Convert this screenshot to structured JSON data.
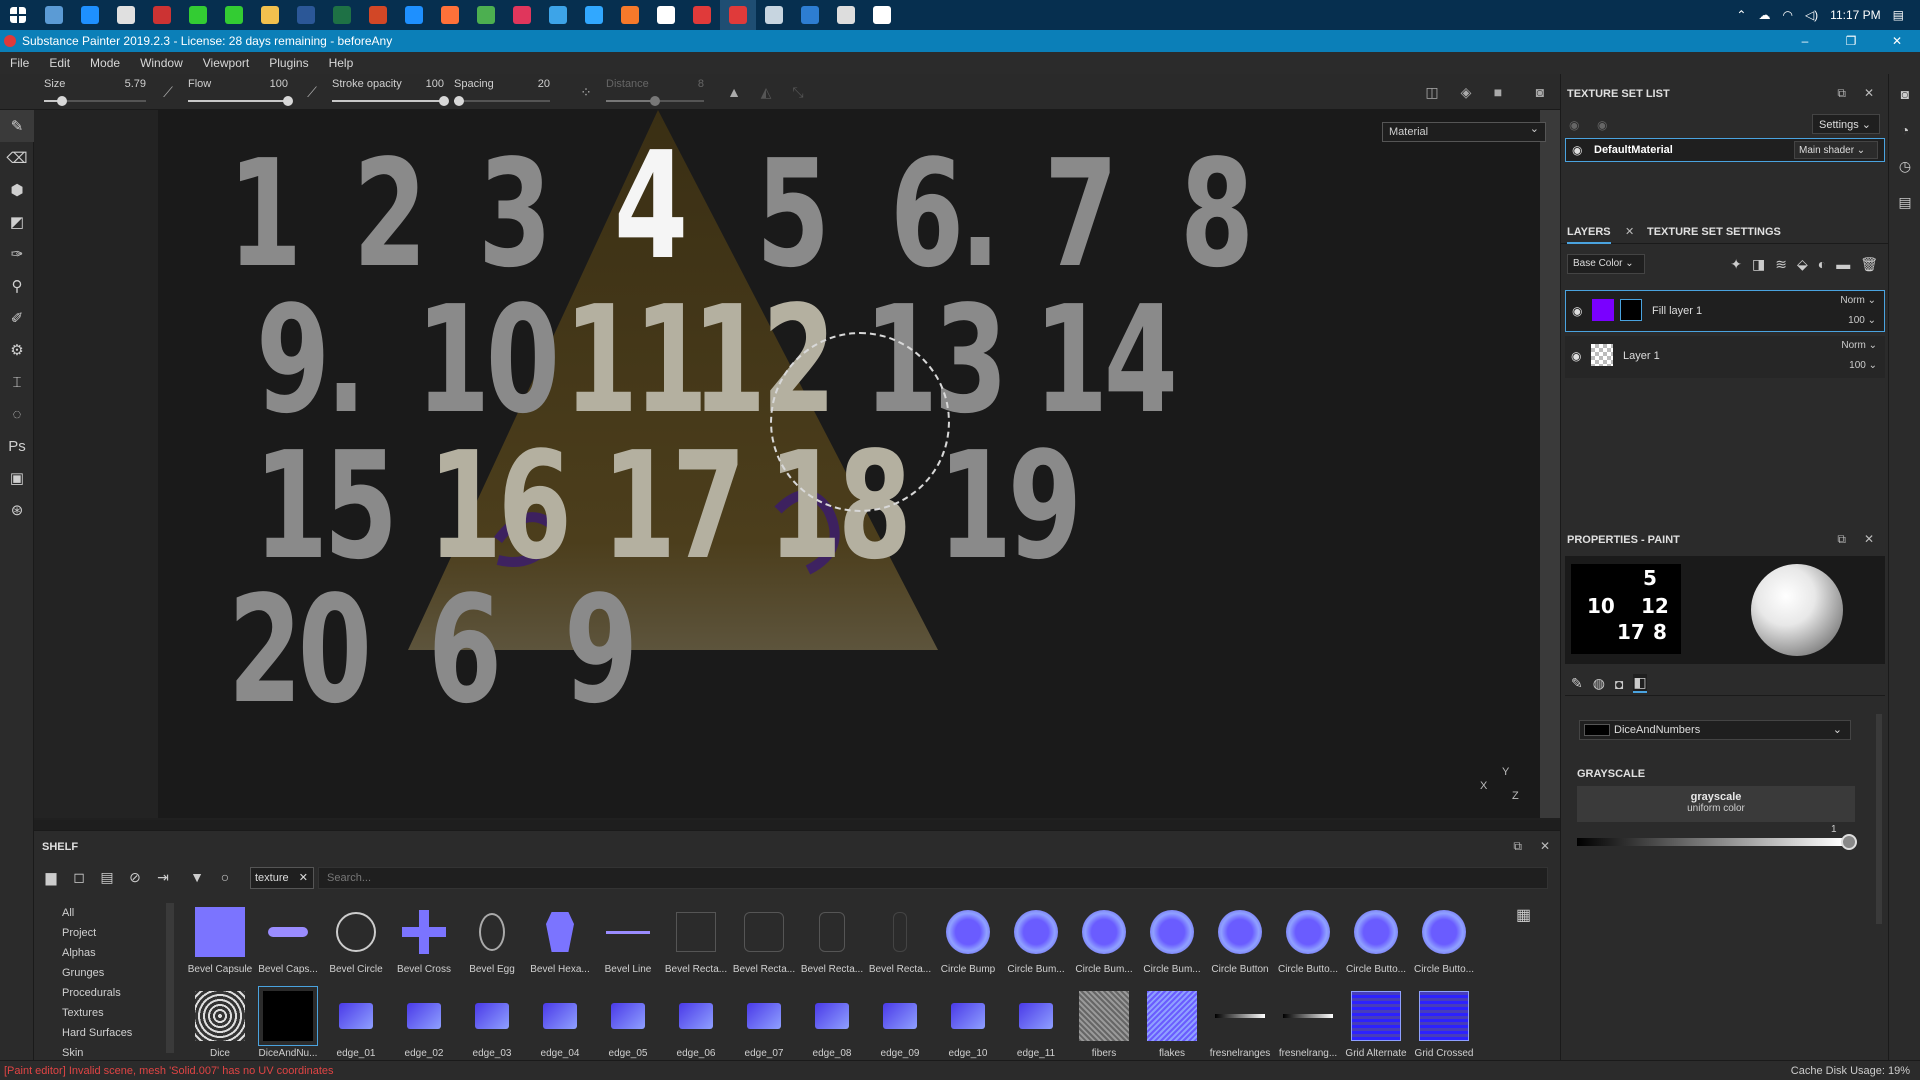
{
  "taskbar": {
    "clock": "11:17 PM",
    "apps": [
      {
        "name": "start-icon",
        "color": "#ffffff"
      },
      {
        "name": "app-icon",
        "color": "#5b9bd5"
      },
      {
        "name": "app-icon",
        "color": "#1e90ff"
      },
      {
        "name": "app-icon",
        "color": "#e0e0e0"
      },
      {
        "name": "app-icon",
        "color": "#cc3333"
      },
      {
        "name": "app-icon",
        "color": "#33cc33"
      },
      {
        "name": "app-icon",
        "color": "#33cc33"
      },
      {
        "name": "folder-icon",
        "color": "#f2c14e"
      },
      {
        "name": "word-icon",
        "color": "#2b5797"
      },
      {
        "name": "excel-icon",
        "color": "#1e7145"
      },
      {
        "name": "powerpoint-icon",
        "color": "#d24726"
      },
      {
        "name": "app-icon",
        "color": "#1e90ff"
      },
      {
        "name": "firefox-icon",
        "color": "#ff7139"
      },
      {
        "name": "chrome-icon",
        "color": "#4caf50"
      },
      {
        "name": "app-icon",
        "color": "#e0365c"
      },
      {
        "name": "lightroom-icon",
        "color": "#3da4e8"
      },
      {
        "name": "photoshop-icon",
        "color": "#31a8ff"
      },
      {
        "name": "blender-icon",
        "color": "#f5792a"
      },
      {
        "name": "unity-icon",
        "color": "#ffffff"
      },
      {
        "name": "app-icon",
        "color": "#e03a3a"
      },
      {
        "name": "substance-painter-icon",
        "color": "#e03a3a"
      },
      {
        "name": "steam-icon",
        "color": "#c7d5e0"
      },
      {
        "name": "app-icon",
        "color": "#2d7dd2"
      },
      {
        "name": "app-icon",
        "color": "#dddddd"
      },
      {
        "name": "app-icon",
        "color": "#ffffff"
      }
    ]
  },
  "title": "Substance Painter 2019.2.3 - License: 28 days remaining - beforeAny",
  "window_controls": {
    "minimize": "–",
    "maximize": "❐",
    "close": "✕"
  },
  "menu": [
    "File",
    "Edit",
    "Mode",
    "Window",
    "Viewport",
    "Plugins",
    "Help"
  ],
  "tool_params": {
    "size": {
      "label": "Size",
      "value": "5.79",
      "fraction": 0.18
    },
    "flow": {
      "label": "Flow",
      "value": "100",
      "fraction": 1.0
    },
    "stroke_opacity": {
      "label": "Stroke opacity",
      "value": "100",
      "fraction": 1.0
    },
    "spacing": {
      "label": "Spacing",
      "value": "20",
      "fraction": 0.05
    },
    "distance": {
      "label": "Distance",
      "value": "8",
      "fraction": 0.5
    }
  },
  "viewport": {
    "mode_select": "Material",
    "gizmo_labels": {
      "x": "X",
      "y": "Y",
      "z": "Z"
    },
    "numbers": [
      "1",
      "2",
      "3",
      "4",
      "5",
      "6.",
      "7",
      "8",
      "9.",
      "10",
      "11",
      "12",
      "13",
      "14",
      "15",
      "16",
      "17",
      "18",
      "19",
      "20",
      "6",
      "9"
    ]
  },
  "shelf": {
    "title": "SHELF",
    "filter_chip": "texture",
    "search_placeholder": "Search...",
    "categories": [
      "All",
      "Project",
      "Alphas",
      "Grunges",
      "Procedurals",
      "Textures",
      "Hard Surfaces",
      "Skin"
    ],
    "items": [
      "Bevel Capsule",
      "Bevel Caps...",
      "Bevel Circle",
      "Bevel Cross",
      "Bevel Egg",
      "Bevel Hexa...",
      "Bevel Line",
      "Bevel Recta...",
      "Bevel Recta...",
      "Bevel Recta...",
      "Bevel Recta...",
      "Circle Bump",
      "Circle Bum...",
      "Circle Bum...",
      "Circle Bum...",
      "Circle Button",
      "Circle Butto...",
      "Circle Butto...",
      "Circle Butto...",
      "Dice",
      "DiceAndNu...",
      "edge_01",
      "edge_02",
      "edge_03",
      "edge_04",
      "edge_05",
      "edge_06",
      "edge_07",
      "edge_08",
      "edge_09",
      "edge_10",
      "edge_11",
      "fibers",
      "flakes",
      "fresnelranges",
      "fresnelrang...",
      "Grid Alternate",
      "Grid Crossed"
    ]
  },
  "texture_set_list": {
    "title": "TEXTURE SET LIST",
    "settings_label": "Settings",
    "material_name": "DefaultMaterial",
    "shader": "Main shader"
  },
  "layers": {
    "tab_layers": "LAYERS",
    "tab_tss": "TEXTURE SET SETTINGS",
    "channel": "Base Color",
    "rows": [
      {
        "name": "Fill layer 1",
        "blend": "Norm",
        "opacity": "100",
        "color": "#7a00ff"
      },
      {
        "name": "Layer 1",
        "blend": "Norm",
        "opacity": "100",
        "color": "checker"
      }
    ]
  },
  "properties": {
    "title": "PROPERTIES - PAINT",
    "texture_name": "DiceAndNumbers",
    "section": "GRAYSCALE",
    "gs_name": "grayscale",
    "gs_type": "uniform color",
    "gs_value": "1",
    "mini_numbers": [
      "5",
      "10",
      "12",
      "17",
      "8"
    ]
  },
  "status": {
    "error": "[Paint editor] Invalid scene, mesh 'Solid.007' has no UV coordinates",
    "cache": "Cache Disk Usage:  19%"
  },
  "accent": "#4aa3df"
}
